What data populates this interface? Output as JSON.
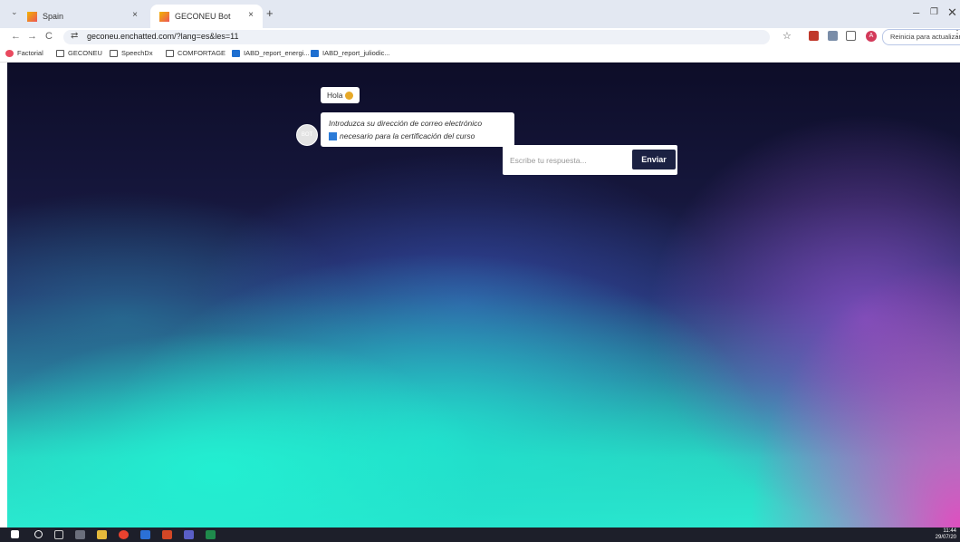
{
  "browser": {
    "tabs": [
      {
        "label": "Spain"
      },
      {
        "label": "GECONEU Bot"
      }
    ],
    "new_tab_symbol": "+",
    "close_symbol": "×",
    "url": "geconeu.enchatted.com/?lang=es&les=11",
    "update_button": "Reinicia para actualizar",
    "profile_initial": "A"
  },
  "bookmarks": [
    {
      "label": "Factorial",
      "icon": "factorial-icon"
    },
    {
      "label": "GECONEU",
      "icon": "folder-icon"
    },
    {
      "label": "SpeechDx",
      "icon": "folder-icon"
    },
    {
      "label": "COMFORTAGE",
      "icon": "folder-icon"
    },
    {
      "label": "IABD_report_energi...",
      "icon": "outlook-icon"
    },
    {
      "label": "IABD_report_juliodic...",
      "icon": "outlook-icon"
    }
  ],
  "chat": {
    "greeting": "Hola",
    "message_line1": "Introduzca su dirección de correo electrónico",
    "message_line2": "necesario para la certificación del curso",
    "input_placeholder": "Escribe tu respuesta...",
    "send_label": "Enviar"
  },
  "taskbar": {
    "time": "11:44",
    "date": "29/07/20"
  },
  "colors": {
    "send_button": "#1b2142",
    "accent_teal": "#2be8cf",
    "accent_pink": "#e946be"
  }
}
